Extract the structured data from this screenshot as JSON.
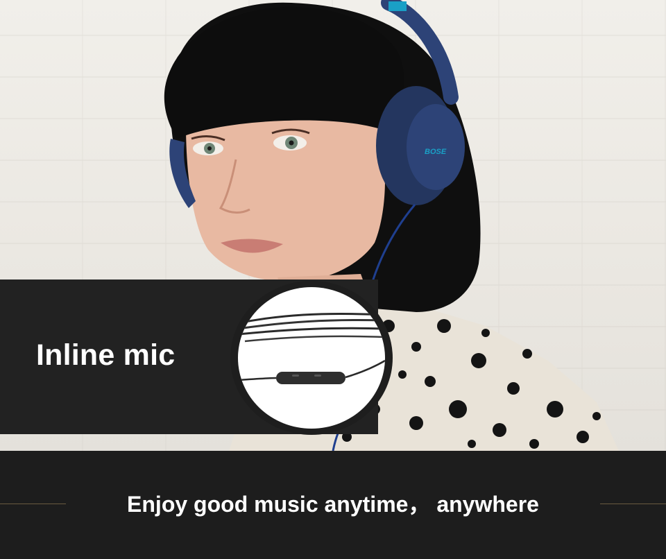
{
  "banner": {
    "label": "Inline mic"
  },
  "footer": {
    "slogan": "Enjoy good music anytime， anywhere"
  },
  "headphones": {
    "brand": "BOSE",
    "color": "#2d4377",
    "accent": "#1aa0c6"
  },
  "colors": {
    "banner_bg": "#222222",
    "footer_bg": "#1d1d1d",
    "footer_line": "#6b5a40"
  }
}
